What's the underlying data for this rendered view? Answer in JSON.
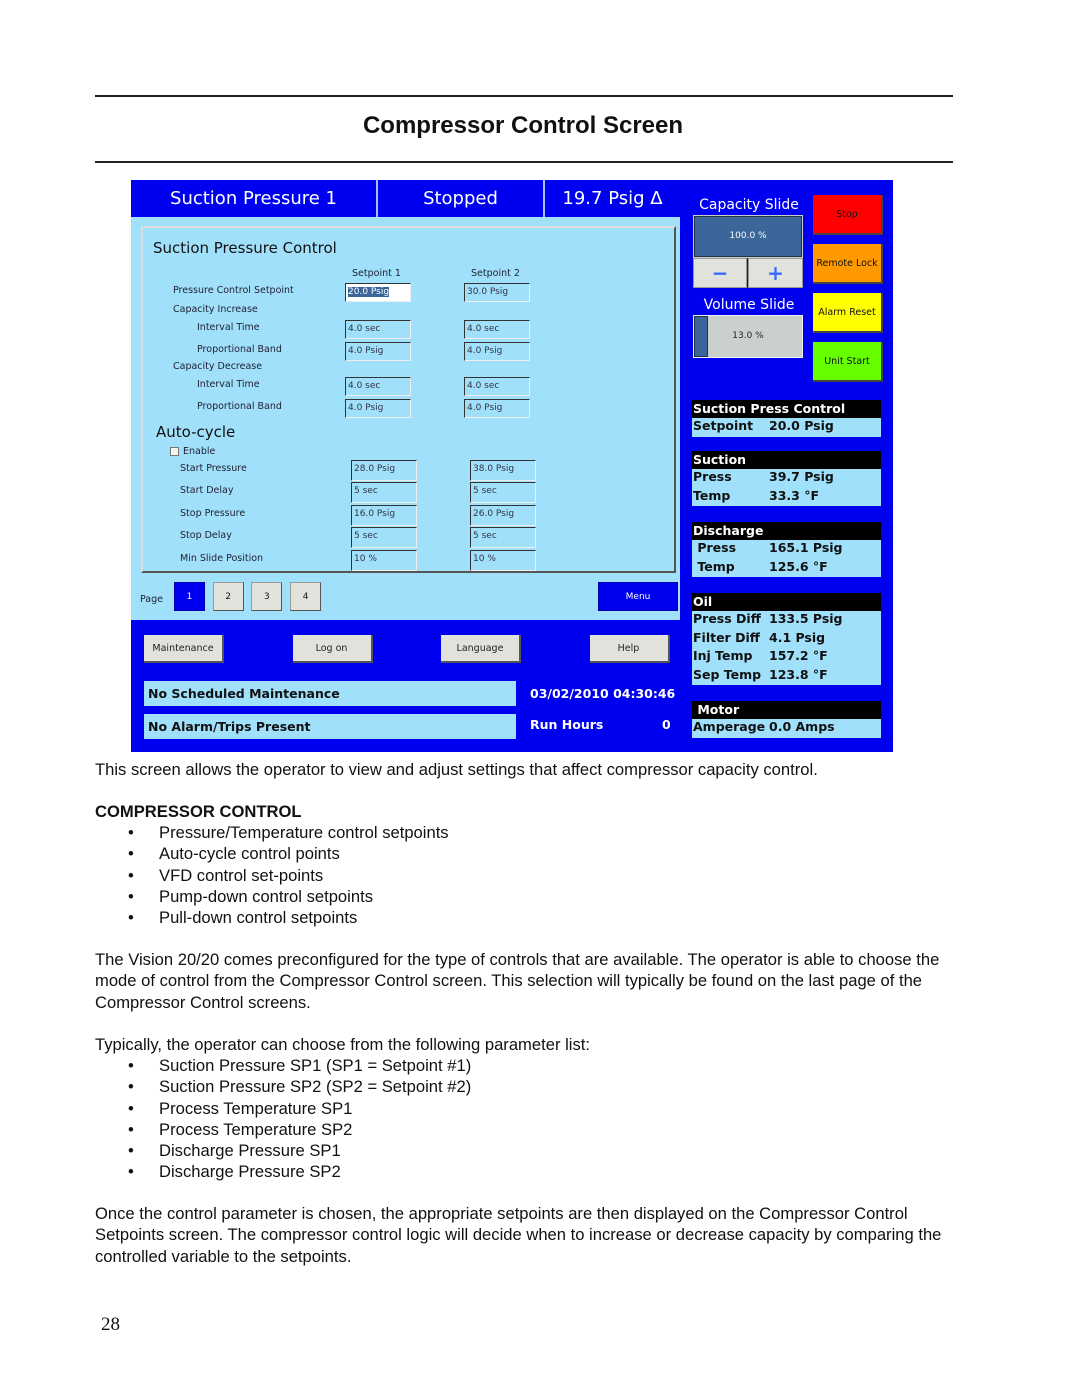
{
  "document": {
    "title": "Compressor Control Screen",
    "intro": "This screen allows the operator to view and adjust settings that affect compressor capacity control.",
    "section_heading": "COMPRESSOR CONTROL",
    "bullets1": [
      "Pressure/Temperature control setpoints",
      "Auto-cycle control points",
      "VFD control set-points",
      "Pump-down control setpoints",
      "Pull-down control setpoints"
    ],
    "para2": "The Vision 20/20 comes preconfigured for the type of controls that are available.  The operator is able to choose the mode of control from the Compressor Control screen.  This selection will typically be found on the last page of the Compressor Control screens.",
    "para3": "Typically, the operator can choose from the following parameter list:",
    "bullets2": [
      "Suction Pressure SP1 (SP1 = Setpoint #1)",
      "Suction Pressure SP2 (SP2 = Setpoint #2)",
      "Process Temperature SP1",
      "Process Temperature SP2",
      "Discharge Pressure SP1",
      "Discharge Pressure SP2"
    ],
    "para4": "Once the control parameter is chosen, the appropriate setpoints are then displayed on the Compressor Control Setpoints screen.  The compressor control logic will decide when to increase or decrease capacity by comparing the controlled variable to the setpoints.",
    "page_number": "28",
    "bullet": "•"
  },
  "screen": {
    "header": {
      "mode": "Suction Pressure 1",
      "state": "Stopped",
      "value": "19.7 Psig Δ"
    },
    "panel_title": "Suction Pressure Control",
    "col1": "Setpoint 1",
    "col2": "Setpoint 2",
    "control_rows": [
      {
        "label": "Pressure Control Setpoint",
        "sp1": "20.0 Psig",
        "sp2": "30.0 Psig"
      },
      {
        "label": "Capacity Increase"
      },
      {
        "label": "Interval Time",
        "sp1": "4.0 sec",
        "sp2": "4.0 sec"
      },
      {
        "label": "Proportional Band",
        "sp1": "4.0 Psig",
        "sp2": "4.0 Psig"
      },
      {
        "label": "Capacity Decrease"
      },
      {
        "label": "Interval Time",
        "sp1": "4.0 sec",
        "sp2": "4.0 sec"
      },
      {
        "label": "Proportional Band",
        "sp1": "4.0 Psig",
        "sp2": "4.0 Psig"
      }
    ],
    "autocycle_title": "Auto-cycle",
    "enable_label": "Enable",
    "enable_checked": false,
    "autocycle_rows": [
      {
        "label": "Start Pressure",
        "sp1": "28.0 Psig",
        "sp2": "38.0 Psig"
      },
      {
        "label": "Start Delay",
        "sp1": "5 sec",
        "sp2": "5 sec"
      },
      {
        "label": "Stop Pressure",
        "sp1": "16.0 Psig",
        "sp2": "26.0 Psig"
      },
      {
        "label": "Stop Delay",
        "sp1": "5 sec",
        "sp2": "5 sec"
      },
      {
        "label": "Min Slide Position",
        "sp1": "10 %",
        "sp2": "10 %"
      }
    ],
    "page_label": "Page",
    "pages": [
      "1",
      "2",
      "3",
      "4"
    ],
    "current_page": "1",
    "menu": "Menu",
    "buttons": [
      "Maintenance",
      "Log on",
      "Language",
      "Help"
    ],
    "maintenance_status": "No Scheduled Maintenance",
    "alarm_status": "No Alarm/Trips Present",
    "datetime": "03/02/2010  04:30:46",
    "run_hours_label": "Run Hours",
    "run_hours": "0",
    "capacity_title": "Capacity Slide",
    "capacity_value": "100.0 %",
    "capacity_percent": 100,
    "minus": "−",
    "plus": "+",
    "volume_title": "Volume Slide",
    "volume_value": "13.0 %",
    "volume_percent": 13,
    "controls": [
      {
        "label": "Stop",
        "color": "#ff0000"
      },
      {
        "label": "Remote Lock",
        "color": "#ff9900"
      },
      {
        "label": "Alarm Reset",
        "color": "#ffff00"
      },
      {
        "label": "Unit Start",
        "color": "#66ff00"
      }
    ],
    "info": [
      {
        "title": "Suction Press Control",
        "rows": [
          [
            "Setpoint",
            "20.0 Psig"
          ]
        ]
      },
      {
        "title": "Suction",
        "rows": [
          [
            "Press",
            "39.7 Psig"
          ],
          [
            "Temp",
            "33.3 °F"
          ]
        ]
      },
      {
        "title": "Discharge",
        "rows": [
          [
            " Press",
            "165.1 Psig"
          ],
          [
            " Temp",
            "125.6 °F"
          ]
        ]
      },
      {
        "title": "Oil",
        "rows": [
          [
            "Press Diff",
            "133.5 Psig"
          ],
          [
            "Filter Diff",
            "4.1 Psig"
          ],
          [
            "Inj Temp",
            "157.2 °F"
          ],
          [
            "Sep Temp",
            "123.8 °F"
          ]
        ]
      },
      {
        "title": " Motor",
        "rows": [
          [
            "Amperage",
            "0.0 Amps"
          ]
        ]
      }
    ]
  }
}
